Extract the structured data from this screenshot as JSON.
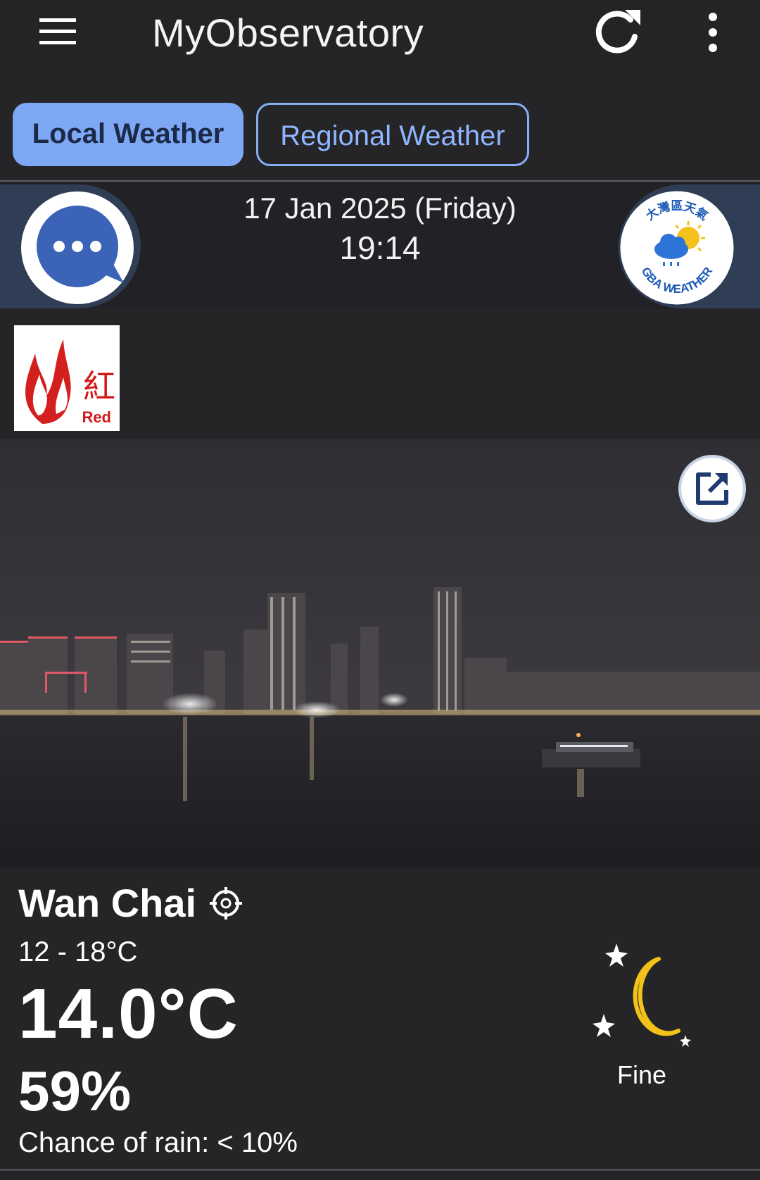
{
  "app": {
    "title": "MyObservatory"
  },
  "tabs": [
    {
      "label": "Local Weather",
      "active": true
    },
    {
      "label": "Regional Weather",
      "active": false
    }
  ],
  "banner": {
    "date": "17 Jan 2025 (Friday)",
    "time": "19:14"
  },
  "warning": {
    "chinese": "紅",
    "english": "Red",
    "icon": "red-fire-danger-warning"
  },
  "gba_logo": {
    "top_text": "大灣區天氣",
    "bottom_text": "GBA WEATHER"
  },
  "weather": {
    "location": "Wan Chai",
    "temp_range": "12 - 18°C",
    "temperature": "14.0°C",
    "humidity": "59%",
    "rain_chance": "Chance of rain: < 10%",
    "condition": "Fine",
    "condition_icon": "moon-stars-icon"
  },
  "colors": {
    "background": "#252528",
    "tab_active": "#7ea7f4",
    "tab_outline": "#86aef5",
    "banner_side": "#2f3d55",
    "moon": "#f2c218",
    "warning_red": "#d11a1a"
  }
}
